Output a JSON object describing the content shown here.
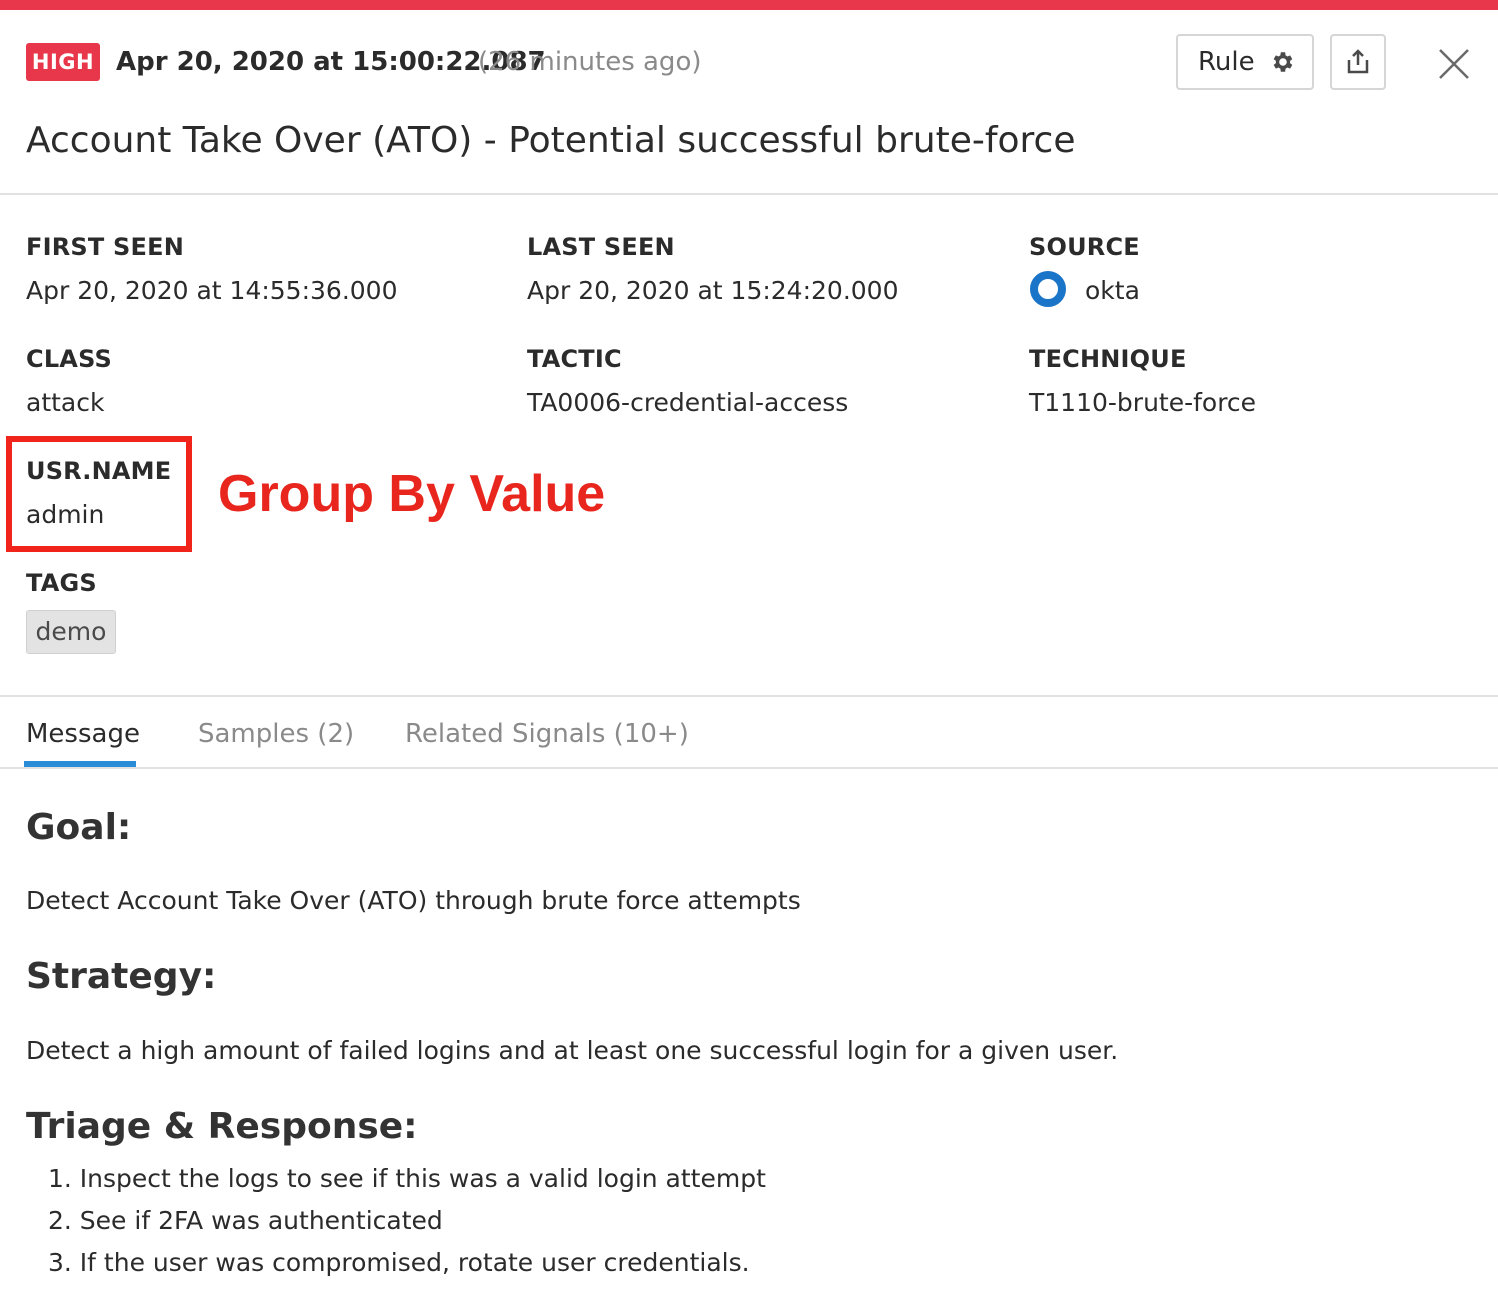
{
  "signal": {
    "severity": "HIGH",
    "timestamp": "Apr 20, 2020 at 15:00:22.087",
    "relative_time": "(26 minutes ago)",
    "title": "Account Take Over (ATO) - Potential successful brute-force"
  },
  "toolbar": {
    "rule_label": "Rule",
    "rule_icon": "gear-icon",
    "export_icon": "export-icon",
    "close_icon": "close-icon"
  },
  "fields": {
    "first_seen": {
      "label": "FIRST SEEN",
      "value": "Apr 20, 2020 at 14:55:36.000"
    },
    "last_seen": {
      "label": "LAST SEEN",
      "value": "Apr 20, 2020 at 15:24:20.000"
    },
    "source": {
      "label": "SOURCE",
      "value": "okta",
      "icon": "okta-icon"
    },
    "class": {
      "label": "CLASS",
      "value": "attack"
    },
    "tactic": {
      "label": "TACTIC",
      "value": "TA0006-credential-access"
    },
    "technique": {
      "label": "TECHNIQUE",
      "value": "T1110-brute-force"
    },
    "usr_name": {
      "label": "USR.NAME",
      "value": "admin"
    },
    "tags": {
      "label": "TAGS",
      "items": [
        "demo"
      ]
    }
  },
  "annotation": {
    "text": "Group By Value",
    "color": "#e8261e"
  },
  "tabs": [
    {
      "label": "Message",
      "active": true
    },
    {
      "label": "Samples (2)",
      "active": false
    },
    {
      "label": "Related Signals (10+)",
      "active": false
    }
  ],
  "message": {
    "goal_heading": "Goal:",
    "goal_text": "Detect Account Take Over (ATO) through brute force attempts",
    "strategy_heading": "Strategy:",
    "strategy_text": "Detect a high amount of failed logins and at least one successful login for a given user.",
    "triage_heading": "Triage & Response:",
    "triage_steps": [
      "1. Inspect the logs to see if this was a valid login attempt",
      "2. See if 2FA was authenticated",
      "3. If the user was compromised, rotate user credentials."
    ]
  },
  "colors": {
    "severity_high": "#e8364a",
    "tab_active_underline": "#2a8bd6",
    "source_icon": "#1a74c8"
  }
}
